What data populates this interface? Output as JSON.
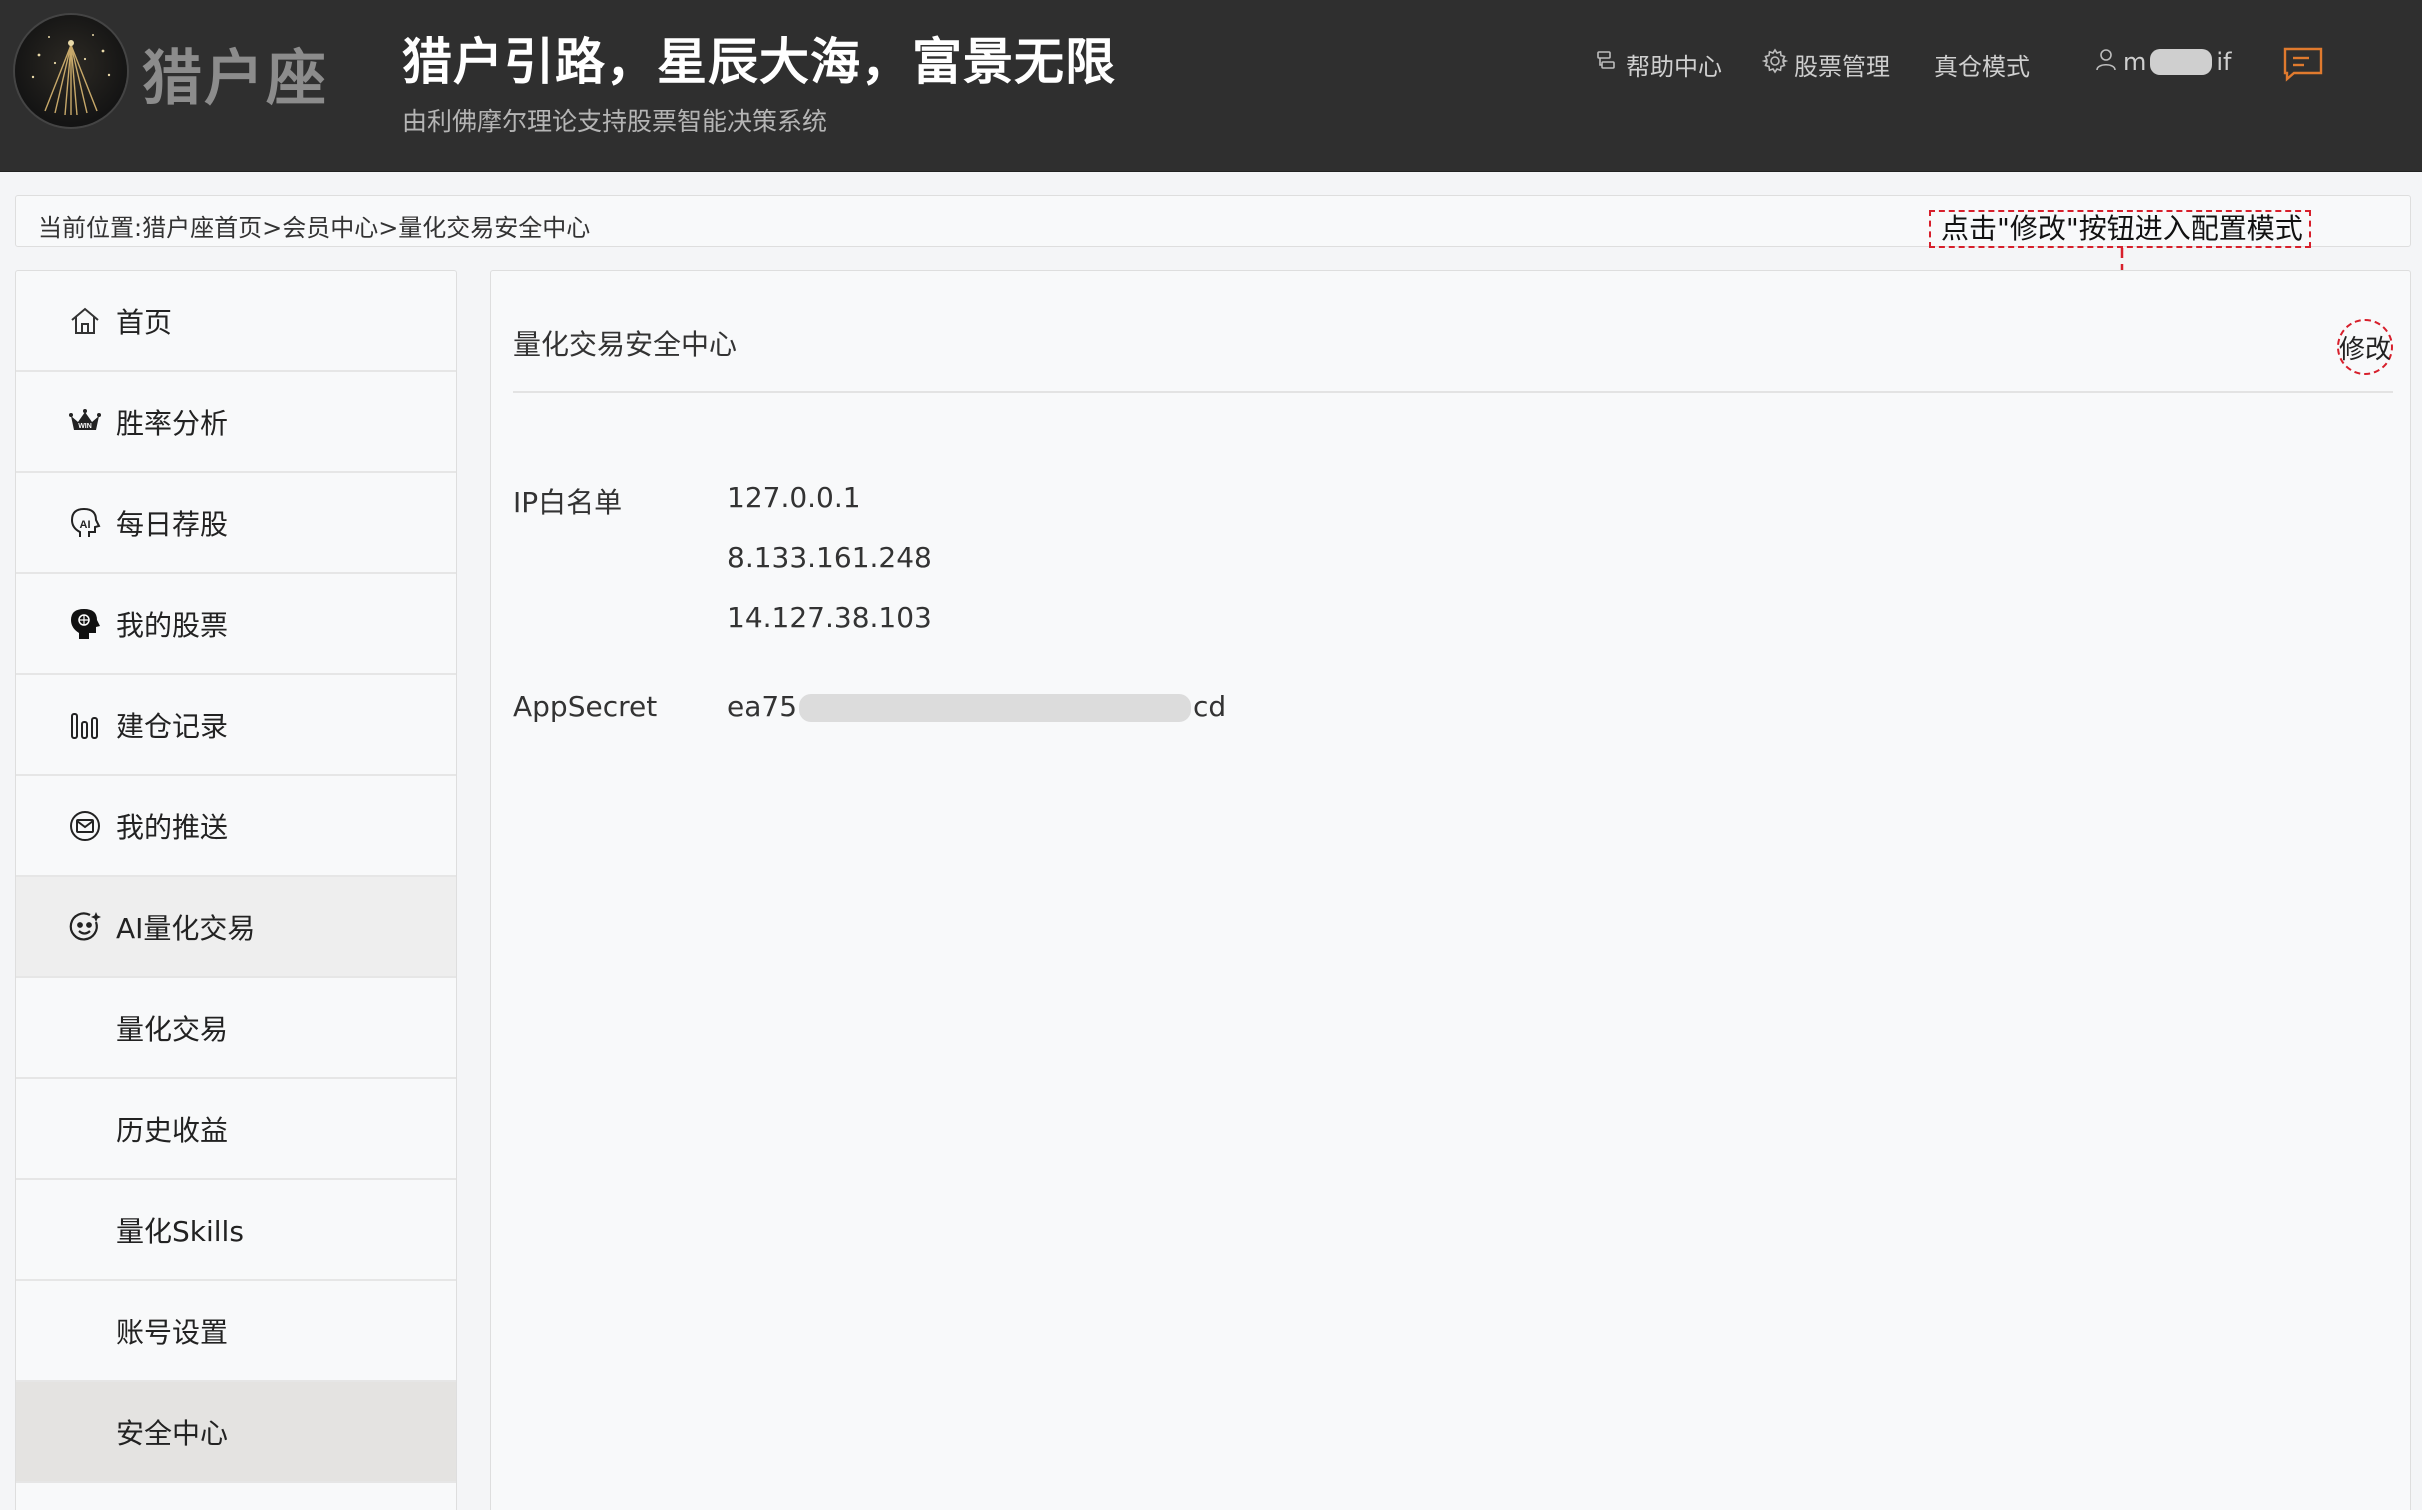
{
  "header": {
    "logo_text": "猎户座",
    "slogan": "猎户引路，星辰大海，富景无限",
    "sub_slogan": "由利佛摩尔理论支持股票智能决策系统",
    "nav": {
      "help": "帮助中心",
      "stock_manage": "股票管理",
      "real_mode": "真仓模式",
      "user_prefix": "m",
      "user_suffix": "if"
    }
  },
  "breadcrumb": {
    "text": "当前位置:猎户座首页>会员中心>量化交易安全中心"
  },
  "hint": {
    "text": "点击\"修改\"按钮进入配置模式",
    "color": "#d71f2b"
  },
  "sidebar": {
    "items": [
      {
        "label": "首页",
        "icon": "home-icon"
      },
      {
        "label": "胜率分析",
        "icon": "crown-icon"
      },
      {
        "label": "每日荐股",
        "icon": "ai-head-icon"
      },
      {
        "label": "我的股票",
        "icon": "brain-head-icon"
      },
      {
        "label": "建仓记录",
        "icon": "bar-chart-icon"
      },
      {
        "label": "我的推送",
        "icon": "mail-circle-icon"
      },
      {
        "label": "AI量化交易",
        "icon": "ai-face-icon"
      },
      {
        "label": "量化交易"
      },
      {
        "label": "历史收益"
      },
      {
        "label": "量化Skills"
      },
      {
        "label": "账号设置"
      },
      {
        "label": "安全中心"
      }
    ],
    "active_index": 11
  },
  "main": {
    "title": "量化交易安全中心",
    "edit_label": "修改",
    "ip_whitelist": {
      "label": "IP白名单",
      "values": [
        "127.0.0.1",
        "8.133.161.248",
        "14.127.38.103"
      ]
    },
    "app_secret": {
      "label": "AppSecret",
      "prefix": "ea75",
      "suffix": "cd"
    }
  },
  "colors": {
    "header_bg": "#2f2f2f",
    "accent_orange": "#e07a2e",
    "hint_red": "#d71f2b",
    "active_item_bg": "#e4e3e1"
  }
}
